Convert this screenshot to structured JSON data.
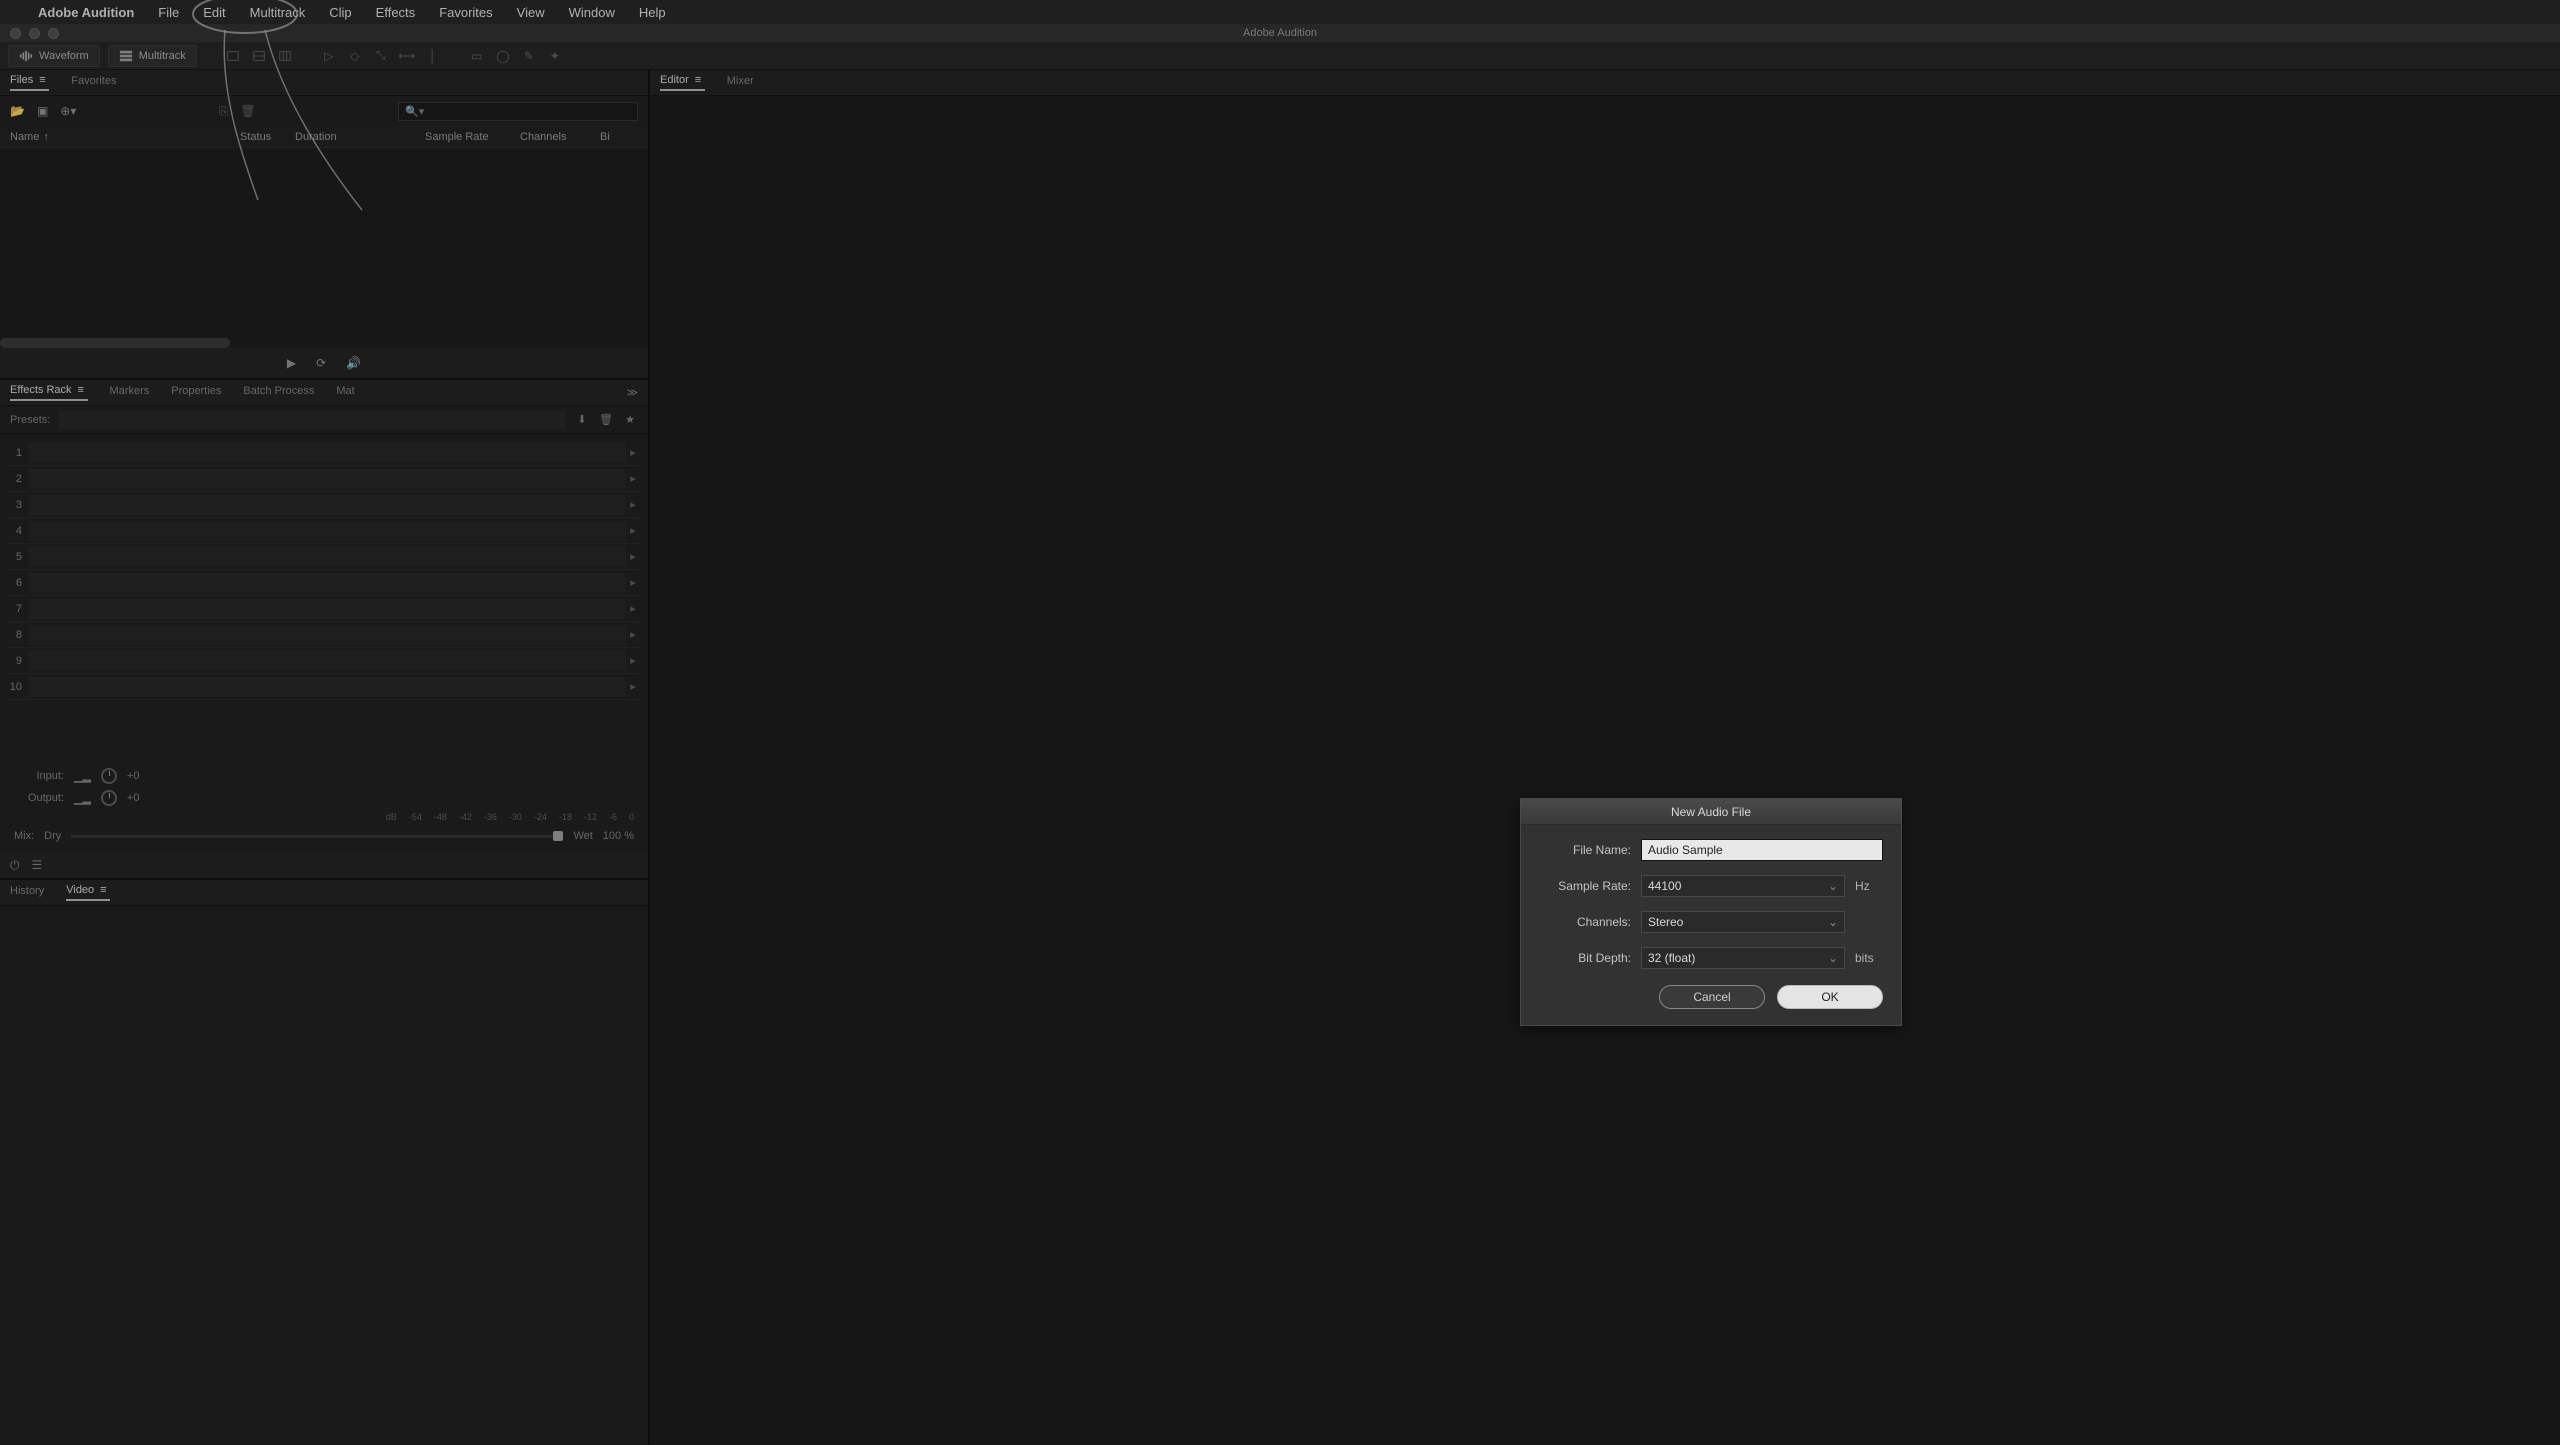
{
  "menubar": {
    "app": "Adobe Audition",
    "items": [
      "File",
      "Edit",
      "Multitrack",
      "Clip",
      "Effects",
      "Favorites",
      "View",
      "Window",
      "Help"
    ]
  },
  "window": {
    "title": "Adobe Audition"
  },
  "toolbar": {
    "waveform": "Waveform",
    "multitrack": "Multitrack"
  },
  "filespanel": {
    "tabs": {
      "files": "Files",
      "favorites": "Favorites"
    },
    "headers": {
      "name": "Name",
      "status": "Status",
      "duration": "Duration",
      "sample_rate": "Sample Rate",
      "channels": "Channels",
      "bit_depth": "Bi"
    },
    "search_placeholder": ""
  },
  "fxpanel": {
    "tabs": {
      "effects_rack": "Effects Rack",
      "markers": "Markers",
      "properties": "Properties",
      "batch": "Batch Process",
      "mat": "Mat"
    },
    "presets_label": "Presets:",
    "slots": [
      "1",
      "2",
      "3",
      "4",
      "5",
      "6",
      "7",
      "8",
      "9",
      "10"
    ],
    "input_label": "Input:",
    "output_label": "Output:",
    "input_val": "+0",
    "output_val": "+0",
    "db_ticks": [
      "dB",
      "-54",
      "-48",
      "-42",
      "-36",
      "-30",
      "-24",
      "-18",
      "-12",
      "-6",
      "0"
    ],
    "mix_label": "Mix:",
    "dry": "Dry",
    "wet": "Wet",
    "mix_pct": "100 %"
  },
  "histpanel": {
    "tabs": {
      "history": "History",
      "video": "Video"
    }
  },
  "editor": {
    "tabs": {
      "editor": "Editor",
      "mixer": "Mixer"
    }
  },
  "dialog": {
    "title": "New Audio File",
    "filename_label": "File Name:",
    "filename_value": "Audio Sample",
    "samplerate_label": "Sample Rate:",
    "samplerate_value": "44100",
    "samplerate_unit": "Hz",
    "channels_label": "Channels:",
    "channels_value": "Stereo",
    "bitdepth_label": "Bit Depth:",
    "bitdepth_value": "32 (float)",
    "bitdepth_unit": "bits",
    "cancel": "Cancel",
    "ok": "OK"
  }
}
